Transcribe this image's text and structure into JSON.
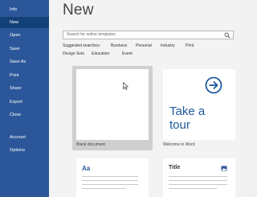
{
  "sidebar": {
    "items": [
      {
        "label": "Info"
      },
      {
        "label": "New"
      },
      {
        "label": "Open"
      },
      {
        "label": "Save"
      },
      {
        "label": "Save As"
      },
      {
        "label": "Print"
      },
      {
        "label": "Share"
      },
      {
        "label": "Export"
      },
      {
        "label": "Close"
      },
      {
        "label": "Account"
      },
      {
        "label": "Options"
      }
    ],
    "active": "New"
  },
  "main": {
    "title": "New",
    "search": {
      "placeholder": "Search for online templates"
    },
    "suggested": {
      "label": "Suggested searches:",
      "links": [
        "Business",
        "Personal",
        "Industry",
        "Print",
        "Design Sets",
        "Education",
        "Event"
      ]
    },
    "templates": [
      {
        "label": "Blank document"
      },
      {
        "label": "Welcome to Word",
        "text_line1": "Take a",
        "text_line2": "tour"
      },
      {
        "label": "",
        "glyph": "Aa"
      },
      {
        "label": "",
        "heading": "Title"
      }
    ]
  },
  "colors": {
    "sidebar": "#2b579a",
    "sidebar_active": "#124078",
    "accent": "#1e5aa0"
  }
}
